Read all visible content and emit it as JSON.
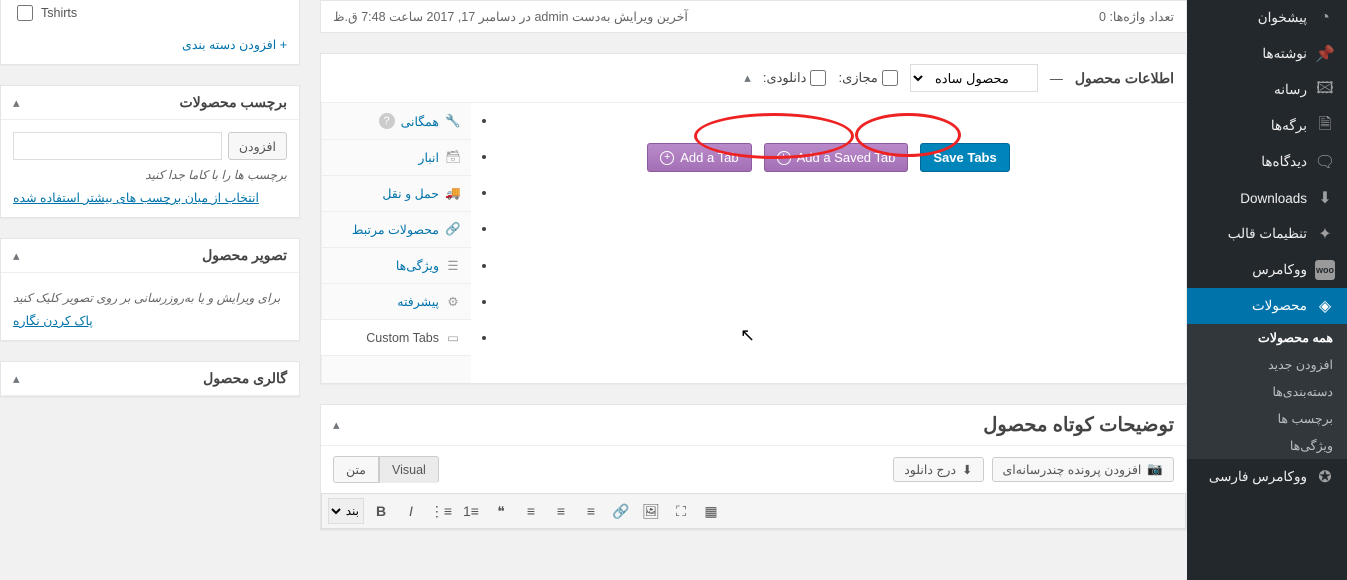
{
  "admin_menu": {
    "dashboard": {
      "label": "پیشخوان",
      "glyph": "◔"
    },
    "posts": {
      "label": "نوشته‌ها",
      "glyph": "📌"
    },
    "media": {
      "label": "رسانه",
      "glyph": "🖾"
    },
    "pages": {
      "label": "برگه‌ها",
      "glyph": "🗎"
    },
    "comments": {
      "label": "دیدگاه‌ها",
      "glyph": "🗨"
    },
    "downloads": {
      "label": "Downloads",
      "glyph": "⬇"
    },
    "theme_opts": {
      "label": "تنظیمات قالب",
      "glyph": "✦"
    },
    "woocommerce": {
      "label": "ووکامرس",
      "glyph": "woo"
    },
    "products": {
      "label": "محصولات",
      "glyph": "◈"
    },
    "woo_fa": {
      "label": "ووکامرس فارسی",
      "glyph": "✪"
    },
    "product_sub": {
      "all": "همه محصولات",
      "add": "افزودن جدید",
      "cats": "دسته‌بندی‌ها",
      "tags": "برچسب ها",
      "attrs": "ویژگی‌ها"
    }
  },
  "revision": {
    "word_count_label": "تعداد واژه‌ها:",
    "word_count_value": "0",
    "last_edit": "آخرین ویرایش به‌دست admin در دسامبر 17, 2017 ساعت 7:48 ق.ظ"
  },
  "sidebar_boxes": {
    "cat_item_tshirts": "Tshirts",
    "add_category_link": "+ افزودن دسته بندی",
    "product_tags": {
      "title": "برچسب محصولات",
      "add_btn": "افزودن",
      "hint": "برچسب ها را با کاما جدا کنید",
      "popular_link": "انتخاب از میان برچسب های بیشتر استفاده شده"
    },
    "product_image": {
      "title": "تصویر محصول",
      "hint": "برای ویرایش و یا به‌روزرسانی بر روی تصویر کلیک کنید",
      "remove_link": "پاک کردن نگاره"
    },
    "product_gallery": {
      "title": "گالری محصول"
    }
  },
  "product_data": {
    "heading": "اطلاعات محصول",
    "dash": "—",
    "type_selected": "محصول ساده",
    "virtual_label": "مجازی:",
    "downloadable_label": "دانلودی:",
    "tabs": {
      "general": "همگانی",
      "inventory": "انبار",
      "shipping": "حمل و نقل",
      "linked": "محصولات مرتبط",
      "attrs": "ویژگی‌ها",
      "advanced": "پیشرفته",
      "custom_tabs": "Custom Tabs"
    },
    "buttons": {
      "add_tab": "Add a Tab",
      "add_saved_tab": "Add a Saved Tab",
      "save_tabs": "Save Tabs"
    }
  },
  "short_desc": {
    "title": "توضیحات کوتاه محصول",
    "add_media": "افزودن پرونده چندرسانه‌ای",
    "insert_download": "درج دانلود",
    "tab_visual": "Visual",
    "tab_text": "متن",
    "block_format": "بند"
  }
}
